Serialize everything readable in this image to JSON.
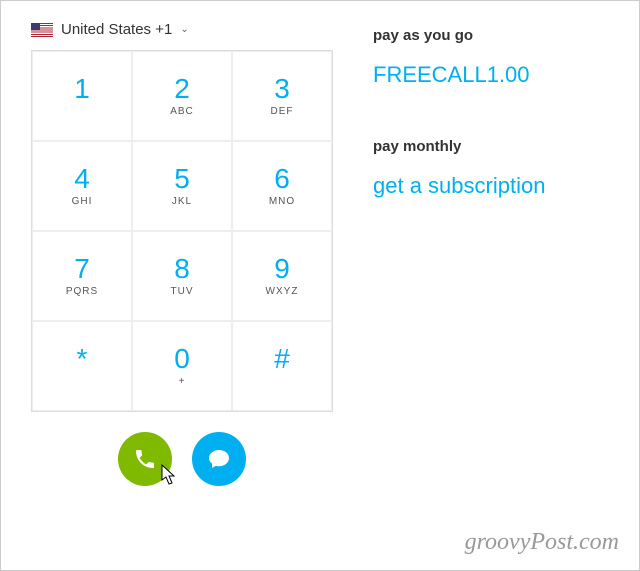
{
  "country": {
    "label": "United States +1"
  },
  "keys": [
    {
      "d": "1",
      "l": ""
    },
    {
      "d": "2",
      "l": "ABC"
    },
    {
      "d": "3",
      "l": "DEF"
    },
    {
      "d": "4",
      "l": "GHI"
    },
    {
      "d": "5",
      "l": "JKL"
    },
    {
      "d": "6",
      "l": "MNO"
    },
    {
      "d": "7",
      "l": "PQRS"
    },
    {
      "d": "8",
      "l": "TUV"
    },
    {
      "d": "9",
      "l": "WXYZ"
    },
    {
      "d": "*",
      "l": ""
    },
    {
      "d": "0",
      "l": "+"
    },
    {
      "d": "#",
      "l": ""
    }
  ],
  "right": {
    "payg_head": "pay as you go",
    "payg_link": "FREECALL1.00",
    "mon_head": "pay monthly",
    "mon_link": "get a subscription"
  },
  "watermark": "groovyPost.com"
}
